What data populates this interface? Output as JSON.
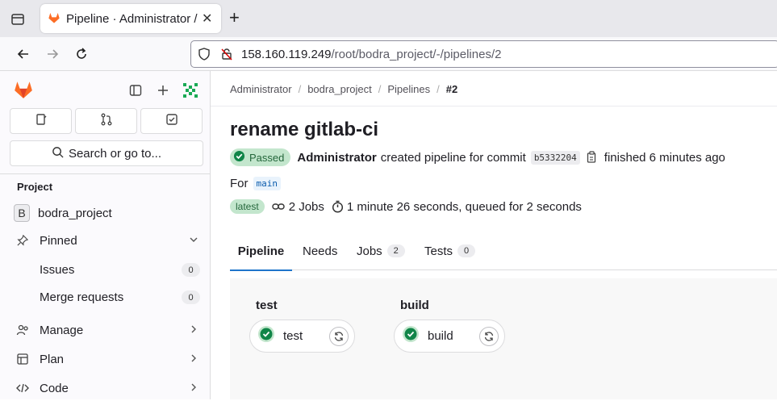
{
  "browser": {
    "tab_title": "Pipeline · Administrator / bodra_project · GitLab",
    "new_tab_symbol": "+",
    "close_symbol": "✕",
    "url_host": "158.160.119.249",
    "url_path": "/root/bodra_project/-/pipelines/2"
  },
  "sidebar": {
    "search_label": "Search or go to...",
    "section_heading": "Project",
    "project": {
      "initial": "B",
      "name": "bodra_project"
    },
    "pinned_label": "Pinned",
    "pinned_items": [
      {
        "label": "Issues",
        "count": "0"
      },
      {
        "label": "Merge requests",
        "count": "0"
      }
    ],
    "menu_items": [
      {
        "label": "Manage",
        "icon": "manage-icon"
      },
      {
        "label": "Plan",
        "icon": "plan-icon"
      },
      {
        "label": "Code",
        "icon": "code-icon"
      }
    ]
  },
  "breadcrumb": [
    "Administrator",
    "bodra_project",
    "Pipelines",
    "#2"
  ],
  "pipeline": {
    "title": "rename gitlab-ci",
    "status": "Passed",
    "author": "Administrator",
    "created_text": "created pipeline for commit",
    "commit_sha": "b5332204",
    "finished_text": "finished 6 minutes ago",
    "for_label": "For",
    "branch": "main",
    "latest_badge": "latest",
    "jobs_text": "2 Jobs",
    "duration_text": "1 minute 26 seconds, queued for 2 seconds"
  },
  "tabs": [
    {
      "label": "Pipeline",
      "count": null
    },
    {
      "label": "Needs",
      "count": null
    },
    {
      "label": "Jobs",
      "count": "2"
    },
    {
      "label": "Tests",
      "count": "0"
    }
  ],
  "stages": [
    {
      "name": "test",
      "job": "test",
      "status": "success"
    },
    {
      "name": "build",
      "job": "build",
      "status": "success"
    }
  ],
  "colors": {
    "accent": "#1f75cb",
    "success": "#108548",
    "gitlab_orange": "#fc6d26"
  }
}
